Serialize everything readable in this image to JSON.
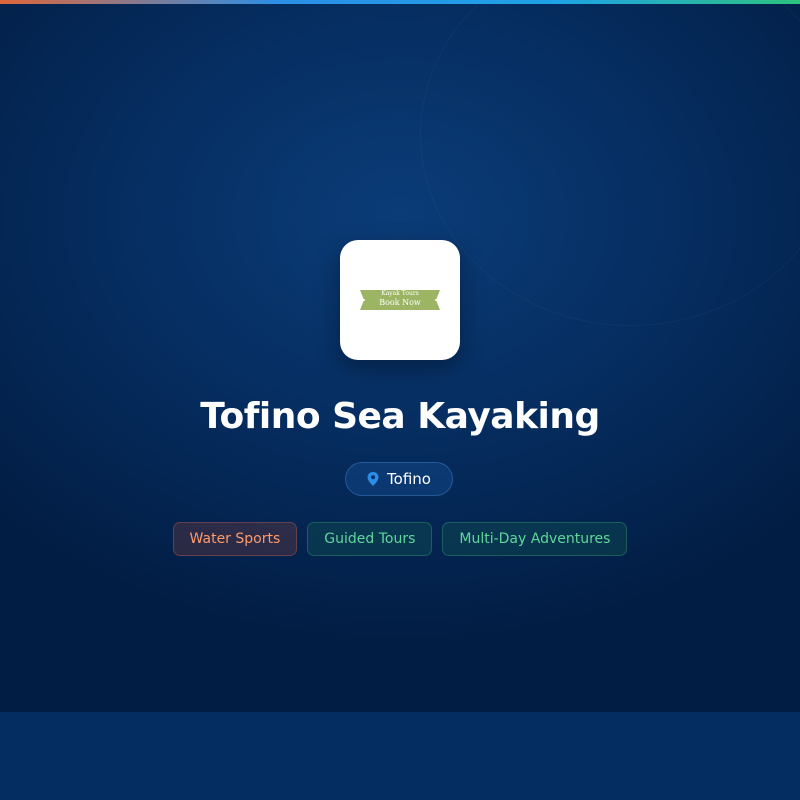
{
  "colors": {
    "accent_blue": "#2b8fe8",
    "tag_orange_text": "#ff9a6a",
    "tag_green_text": "#5fd69a",
    "logo_banner": "#9cb564"
  },
  "logo": {
    "line1": "Kayak Tours",
    "line2": "Book Now"
  },
  "business": {
    "name": "Tofino Sea Kayaking",
    "location": "Tofino",
    "location_icon": "map-pin-icon"
  },
  "tags": [
    {
      "label": "Water Sports",
      "style": "orange"
    },
    {
      "label": "Guided Tours",
      "style": "green"
    },
    {
      "label": "Multi-Day Adventures",
      "style": "green"
    }
  ]
}
